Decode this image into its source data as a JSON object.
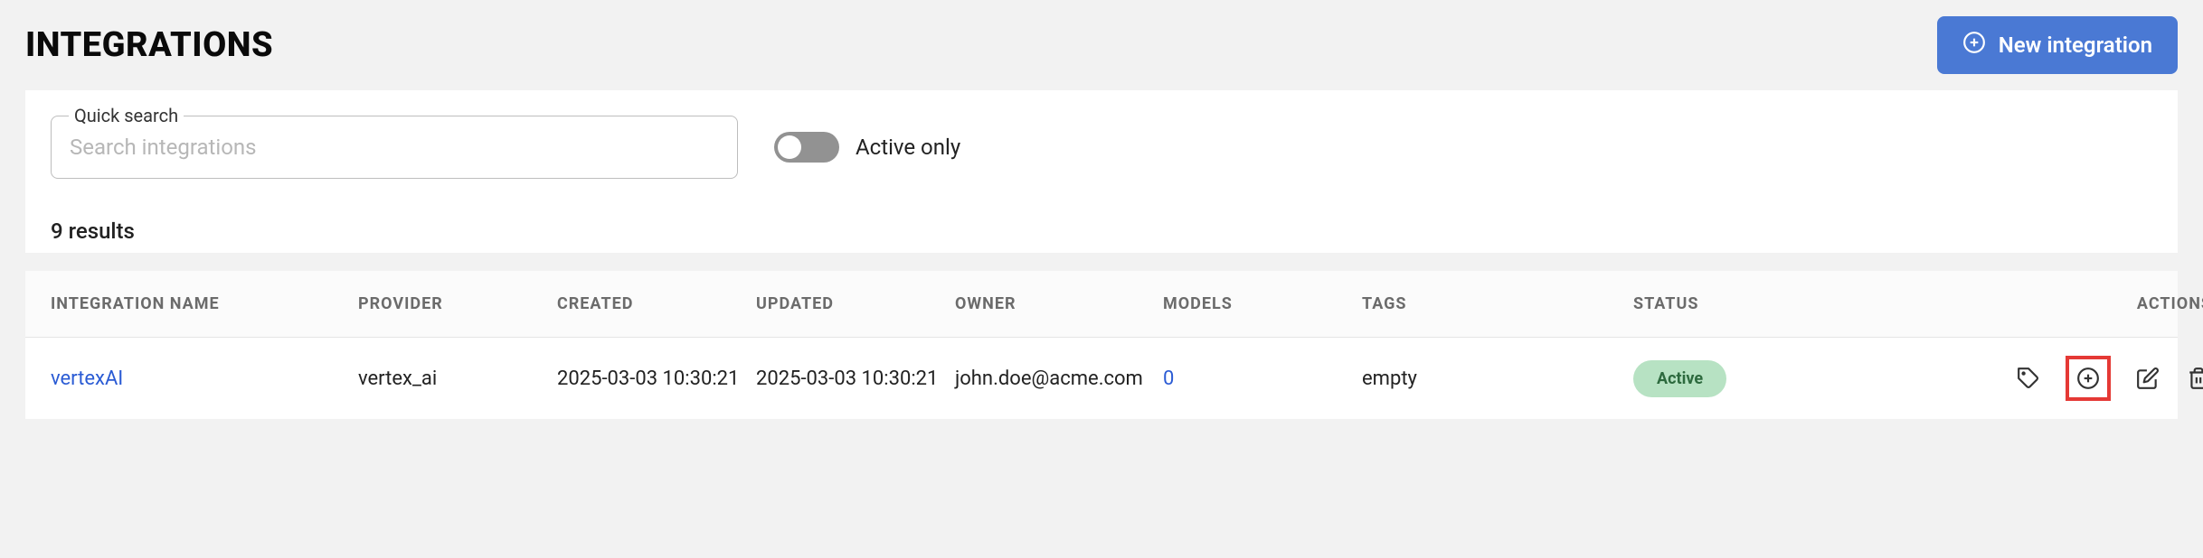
{
  "header": {
    "title": "INTEGRATIONS",
    "new_button_label": "New integration"
  },
  "search": {
    "label": "Quick search",
    "placeholder": "Search integrations",
    "value": ""
  },
  "toggle": {
    "label": "Active only",
    "on": false
  },
  "results_count_text": "9 results",
  "columns": {
    "name": "INTEGRATION NAME",
    "provider": "PROVIDER",
    "created": "CREATED",
    "updated": "UPDATED",
    "owner": "OWNER",
    "models": "MODELS",
    "tags": "TAGS",
    "status": "STATUS",
    "actions": "ACTIONS"
  },
  "rows": [
    {
      "name": "vertexAI",
      "provider": "vertex_ai",
      "created": "2025-03-03 10:30:21",
      "updated": "2025-03-03 10:30:21",
      "owner": "john.doe@acme.com",
      "models": "0",
      "tags": "empty",
      "status": "Active"
    }
  ]
}
